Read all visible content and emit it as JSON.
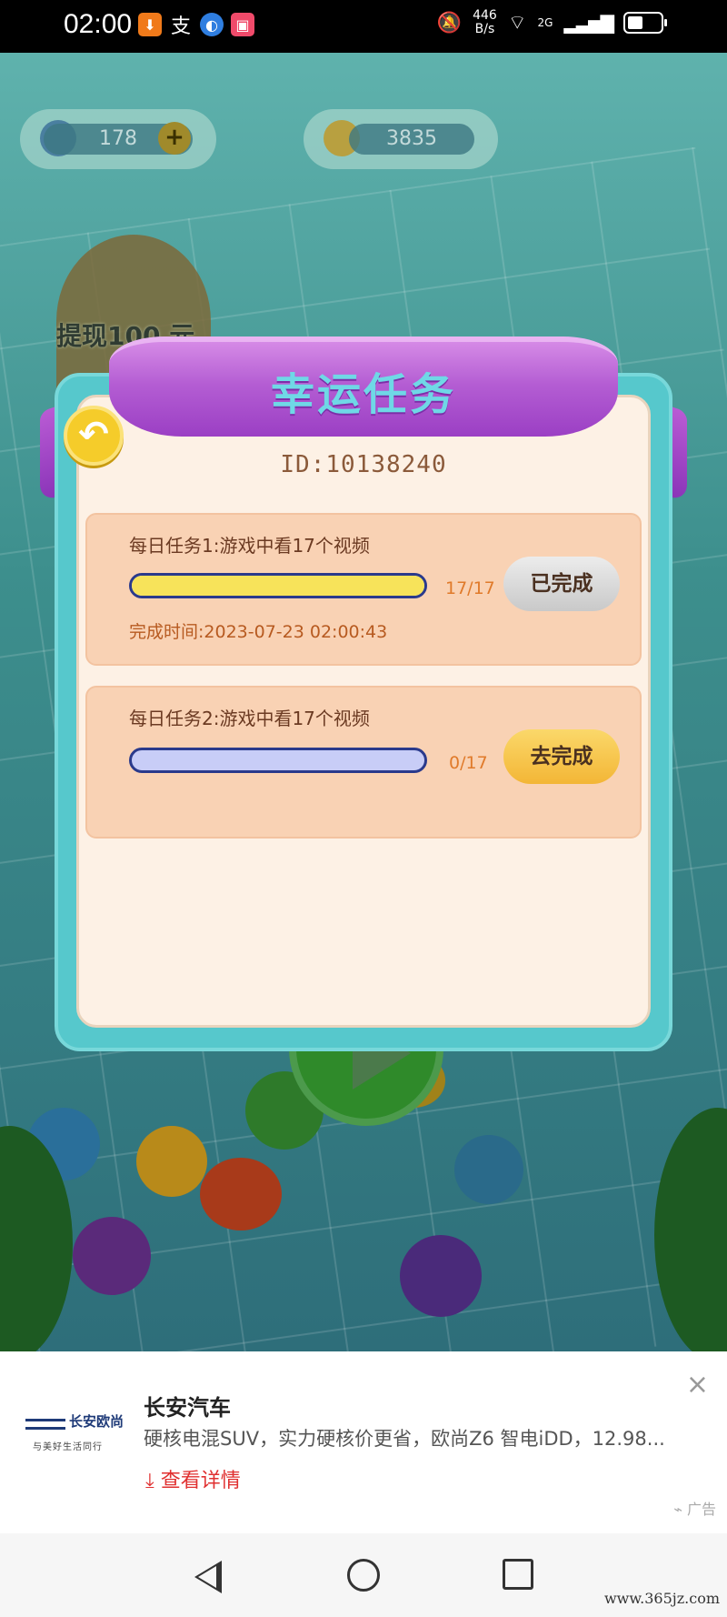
{
  "status_bar": {
    "time": "02:00",
    "net_speed_value": "446",
    "net_speed_unit": "B/s",
    "network_type": "2G",
    "app_icons": [
      "download-app-icon",
      "alipay-icon",
      "browser-icon",
      "video-app-icon"
    ]
  },
  "game_bg": {
    "energy_value": "178",
    "coin_value": "3835",
    "withdraw_label": "提现100 元"
  },
  "dialog": {
    "title": "幸运任务",
    "user_id": "ID:10138240",
    "tasks": [
      {
        "title": "每日任务1:游戏中看17个视频",
        "progress_text": "17/17",
        "progress_fraction": 1.0,
        "button_label": "已完成",
        "completed_time": "完成时间:2023-07-23  02:00:43"
      },
      {
        "title": "每日任务2:游戏中看17个视频",
        "progress_text": "0/17",
        "progress_fraction": 0.0,
        "button_label": "去完成"
      }
    ]
  },
  "ad": {
    "brand_logo_text": "长安欧尚",
    "brand_slogan": "与美好生活同行",
    "title": "长安汽车",
    "description": "硬核电混SUV，实力硬核价更省，欧尚Z6 智电iDD，12.98...",
    "cta": "查看详情",
    "tag": "广告",
    "close": "×"
  },
  "watermark": "www.365jz.com",
  "colors": {
    "ribbon": "#b45dd3",
    "title_text": "#6fd8e6",
    "dialog_frame": "#56c8cc",
    "panel": "#fdf1e5",
    "task_card": "#f9d2b4",
    "bar_complete": "#f7e35a",
    "bar_empty": "#c8cdf7",
    "btn_done": "#d8d8d8",
    "btn_go": "#f7c24a",
    "ad_cta": "#e03030"
  }
}
